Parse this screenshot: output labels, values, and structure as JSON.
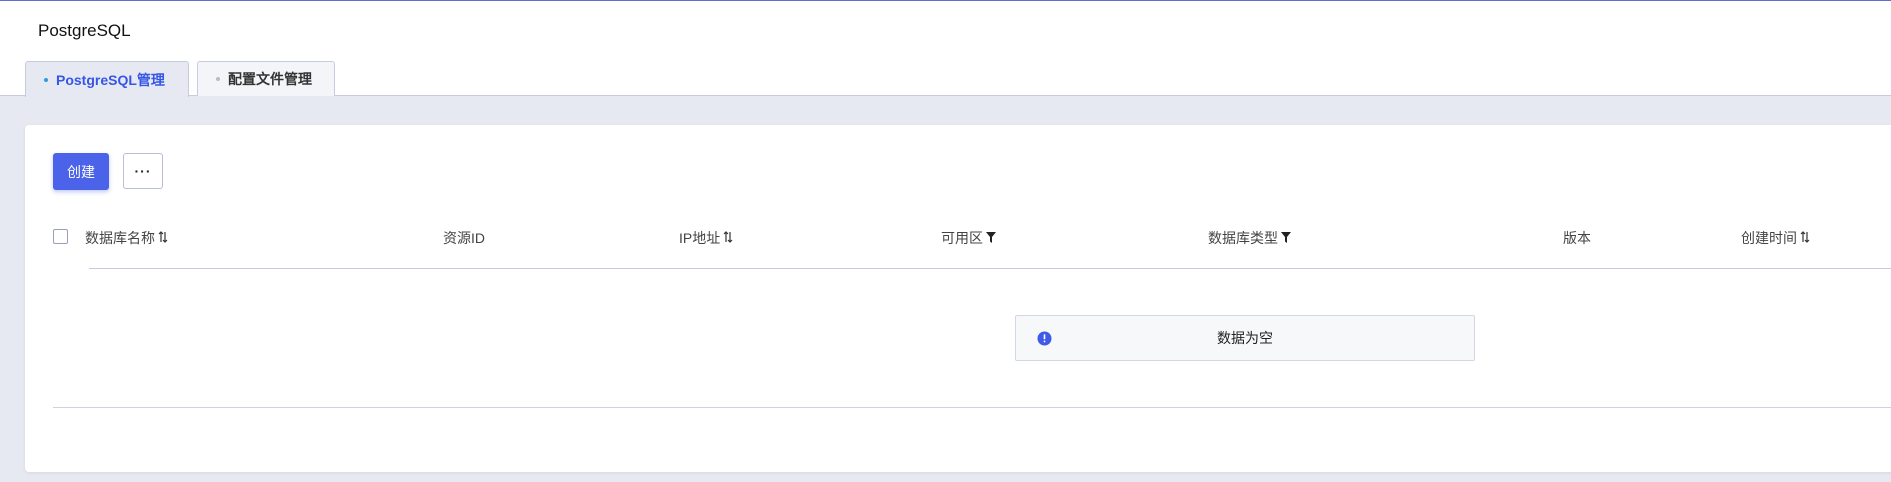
{
  "header": {
    "title": "PostgreSQL",
    "tabs": [
      {
        "label": "PostgreSQL管理",
        "active": true
      },
      {
        "label": "配置文件管理",
        "active": false
      }
    ]
  },
  "toolbar": {
    "create_label": "创建",
    "more_label": "···"
  },
  "table": {
    "columns": [
      {
        "label": "数据库名称",
        "icon": "sort-icon"
      },
      {
        "label": "资源ID",
        "icon": ""
      },
      {
        "label": "IP地址",
        "icon": "sort-icon"
      },
      {
        "label": "可用区",
        "icon": "filter-icon"
      },
      {
        "label": "数据库类型",
        "icon": "filter-icon"
      },
      {
        "label": "版本",
        "icon": ""
      },
      {
        "label": "创建时间",
        "icon": "sort-icon"
      }
    ],
    "rows": [],
    "empty_text": "数据为空"
  },
  "colors": {
    "accent": "#4a63e8",
    "tab_active_text": "#3656e6",
    "background": "#e7e9f2",
    "info_icon": "#3f5be6"
  }
}
